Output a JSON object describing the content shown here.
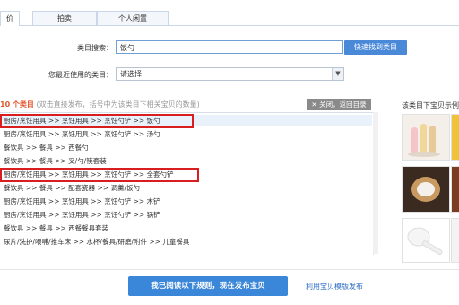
{
  "tabs": [
    {
      "label": "价"
    },
    {
      "label": "拍卖"
    },
    {
      "label": "个人闲置"
    }
  ],
  "search": {
    "label": "类目搜索：",
    "value": "饭勺",
    "button": "快速找到类目"
  },
  "recent": {
    "label": "您最近使用的类目：",
    "value": "请选择"
  },
  "list": {
    "count": "10 个类目",
    "hint": "(双击直接发布，括号中为该类目下相关宝贝的数量)",
    "close_label": "关闭，返回目录",
    "rows": [
      "厨房/烹饪用具 >> 烹饪用具 >> 烹饪勺铲 >> 饭勺",
      "厨房/烹饪用具 >> 烹饪用具 >> 烹饪勺铲 >> 汤勺",
      "餐饮具 >> 餐具 >> 西餐勺",
      "餐饮具 >> 餐具 >> 叉/勺/筷套装",
      "厨房/烹饪用具 >> 烹饪用具 >> 烹饪勺铲 >> 全套勺铲",
      "餐饮具 >> 餐具 >> 配套瓷器 >> 调羹/饭勺",
      "厨房/烹饪用具 >> 烹饪用具 >> 烹饪勺铲 >> 木铲",
      "厨房/烹饪用具 >> 烹饪用具 >> 烹饪勺铲 >> 锅铲",
      "餐饮具 >> 餐具 >> 西餐餐具套装",
      "尿片/洗护/喂哺/推车床 >> 水杯/餐具/研磨/附件 >> 儿童餐具"
    ]
  },
  "right_panel": {
    "title": "该类目下宝贝示例"
  },
  "footer": {
    "publish": "我已阅读以下规则，现在发布宝贝",
    "template_link": "利用宝贝模版发布"
  },
  "colors": {
    "accent": "#3a86d8",
    "highlight_border": "#d81e1e",
    "count": "#e4572e"
  }
}
